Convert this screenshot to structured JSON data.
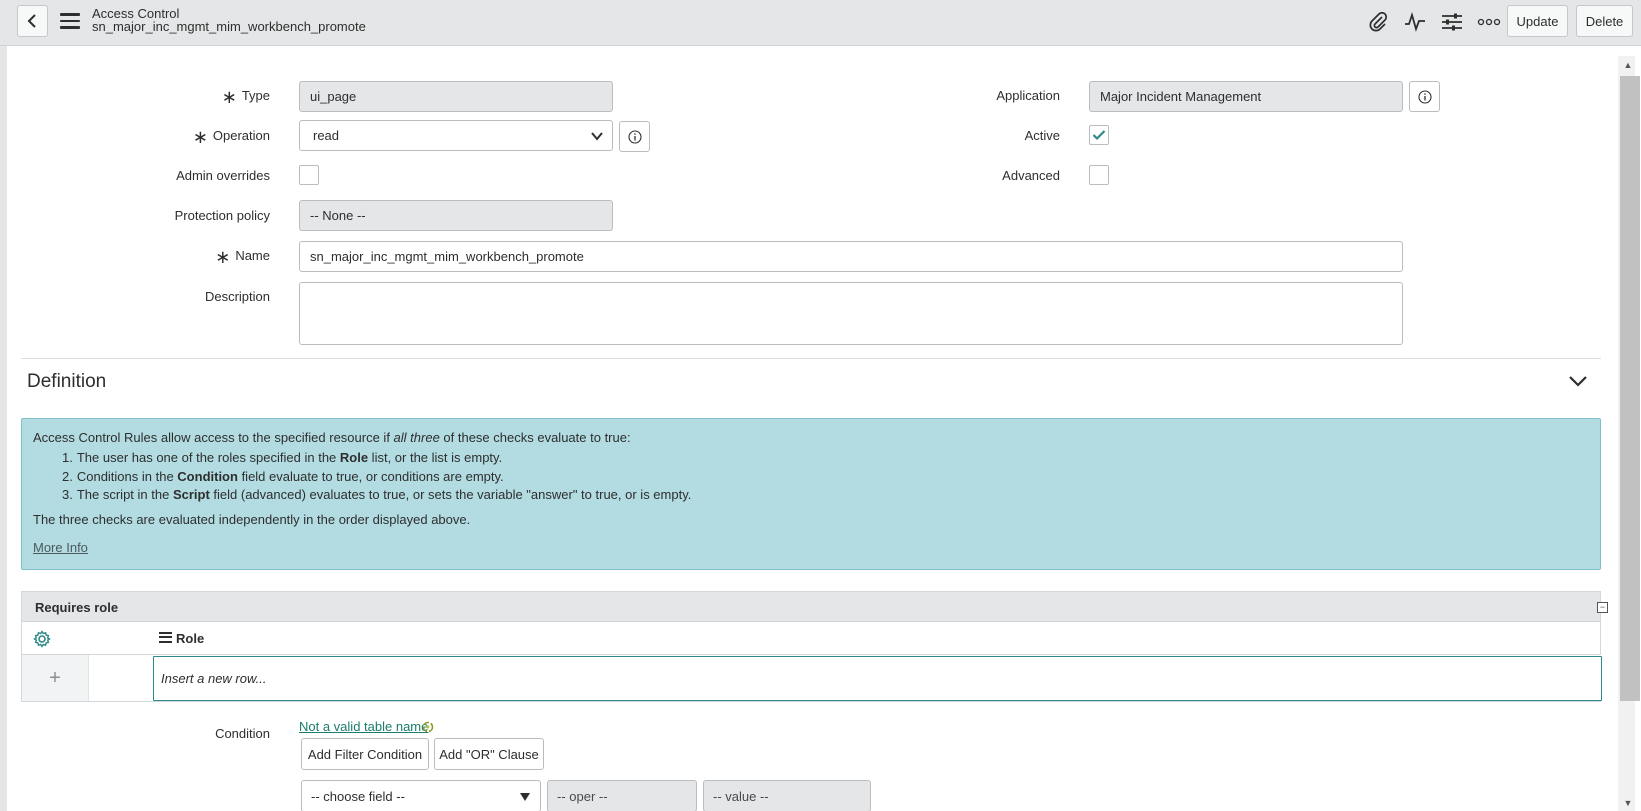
{
  "header": {
    "title": "Access Control",
    "subtitle": "sn_major_inc_mgmt_mim_workbench_promote",
    "update_label": "Update",
    "delete_label": "Delete",
    "icons": [
      "back-icon",
      "menu-icon",
      "paperclip-icon",
      "activity-icon",
      "sliders-icon",
      "more-icon"
    ]
  },
  "form": {
    "type": {
      "label": "Type",
      "value": "ui_page",
      "required": true
    },
    "operation": {
      "label": "Operation",
      "value": "read",
      "required": true
    },
    "admin_overrides": {
      "label": "Admin overrides",
      "checked": false
    },
    "protection_policy": {
      "label": "Protection policy",
      "value": "-- None --"
    },
    "name": {
      "label": "Name",
      "value": "sn_major_inc_mgmt_mim_workbench_promote",
      "required": true
    },
    "description": {
      "label": "Description",
      "value": ""
    },
    "application": {
      "label": "Application",
      "value": "Major Incident Management"
    },
    "active": {
      "label": "Active",
      "checked": true
    },
    "advanced": {
      "label": "Advanced",
      "checked": false
    }
  },
  "definition": {
    "title": "Definition",
    "intro_pre": "Access Control Rules allow access to the specified resource if ",
    "intro_em": "all three",
    "intro_post": " of these checks evaluate to true:",
    "items": [
      {
        "num": "1.",
        "pre": "The user has one of the roles specified in the ",
        "bold": "Role",
        "post": " list, or the list is empty."
      },
      {
        "num": "2.",
        "pre": "Conditions in the ",
        "bold": "Condition",
        "post": " field evaluate to true, or conditions are empty."
      },
      {
        "num": "3.",
        "pre": "The script in the ",
        "bold": "Script",
        "post": " field (advanced) evaluates to true, or sets the variable \"answer\" to true, or is empty."
      }
    ],
    "footer": "The three checks are evaluated independently in the order displayed above.",
    "more_info": "More Info"
  },
  "requires_role": {
    "title": "Requires role",
    "collapse_symbol": "−",
    "column": "Role",
    "add_symbol": "+",
    "insert_placeholder": "Insert a new row..."
  },
  "condition": {
    "label": "Condition",
    "link": "Not a valid table name",
    "add_filter": "Add Filter Condition",
    "add_or": "Add \"OR\" Clause",
    "field_placeholder": "-- choose field --",
    "oper_placeholder": "-- oper --",
    "value_placeholder": "-- value --"
  },
  "colors": {
    "accent": "#2e8a88",
    "info_bg": "#b2dce2",
    "header_bg": "#e4e6e7"
  }
}
